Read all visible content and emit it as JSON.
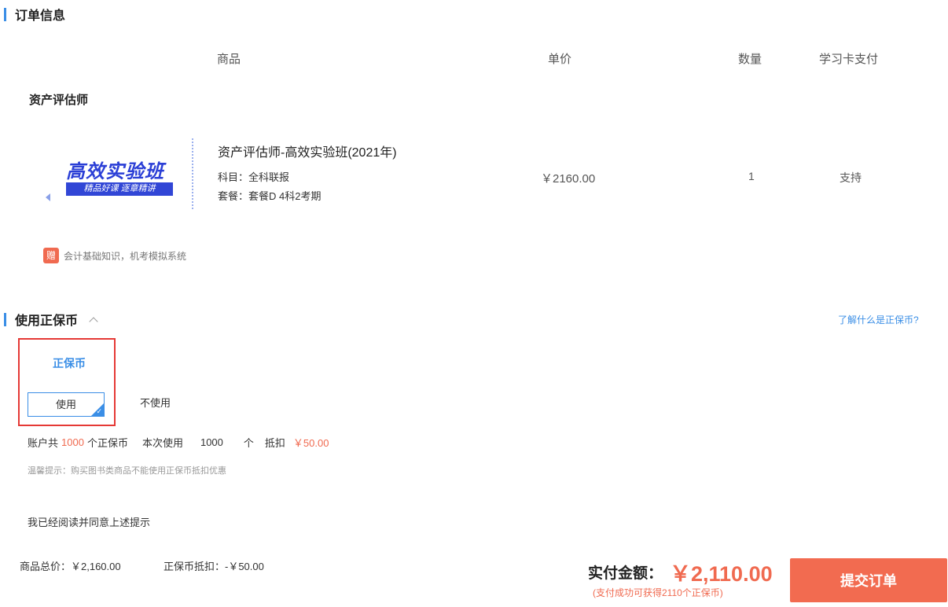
{
  "order_section": {
    "title": "订单信息"
  },
  "columns": {
    "product": "商品",
    "unit_price": "单价",
    "quantity": "数量",
    "card_pay": "学习卡支付"
  },
  "course_group": "资产评估师",
  "thumbnail": {
    "main_text": "高效实验班",
    "sub_text": "精品好课 逐章精讲"
  },
  "product": {
    "name": "资产评估师-高效实验班(2021年)",
    "subject": "科目：全科联报",
    "package": "套餐：套餐D 4科2考期",
    "price": "￥2160.00",
    "quantity": "1",
    "card_pay_support": "支持"
  },
  "gift": {
    "badge": "赠",
    "text": "会计基础知识，机考模拟系统"
  },
  "coin_section": {
    "title": "使用正保币",
    "help_link": "了解什么是正保币?",
    "coin_label": "正保币",
    "use_label": "使用",
    "no_use_label": "不使用",
    "account_prefix": "账户共",
    "account_amount": "1000",
    "account_suffix": "个正保币",
    "this_use_label": "本次使用",
    "this_use_value": "1000",
    "unit": "个",
    "deduct_label": "抵扣",
    "deduct_value": "￥50.00",
    "tip": "温馨提示：购买图书类商品不能使用正保币抵扣优惠"
  },
  "agreement_text": "我已经阅读并同意上述提示",
  "summary": {
    "goods_total": "商品总价：￥2,160.00",
    "coin_deduct": "正保币抵扣：-￥50.00",
    "pay_label": "实付金额：",
    "pay_amount": "￥2,110.00",
    "pay_note": "(支付成功可获得2110个正保币)",
    "submit_label": "提交订单"
  },
  "colors": {
    "accent": "#3a8ee6",
    "price_red": "#f06a50",
    "submit_bg": "#f26b50",
    "highlight_border": "#e53935"
  },
  "icons": {
    "collapse": "chevron-up-icon",
    "selected": "check-icon"
  }
}
